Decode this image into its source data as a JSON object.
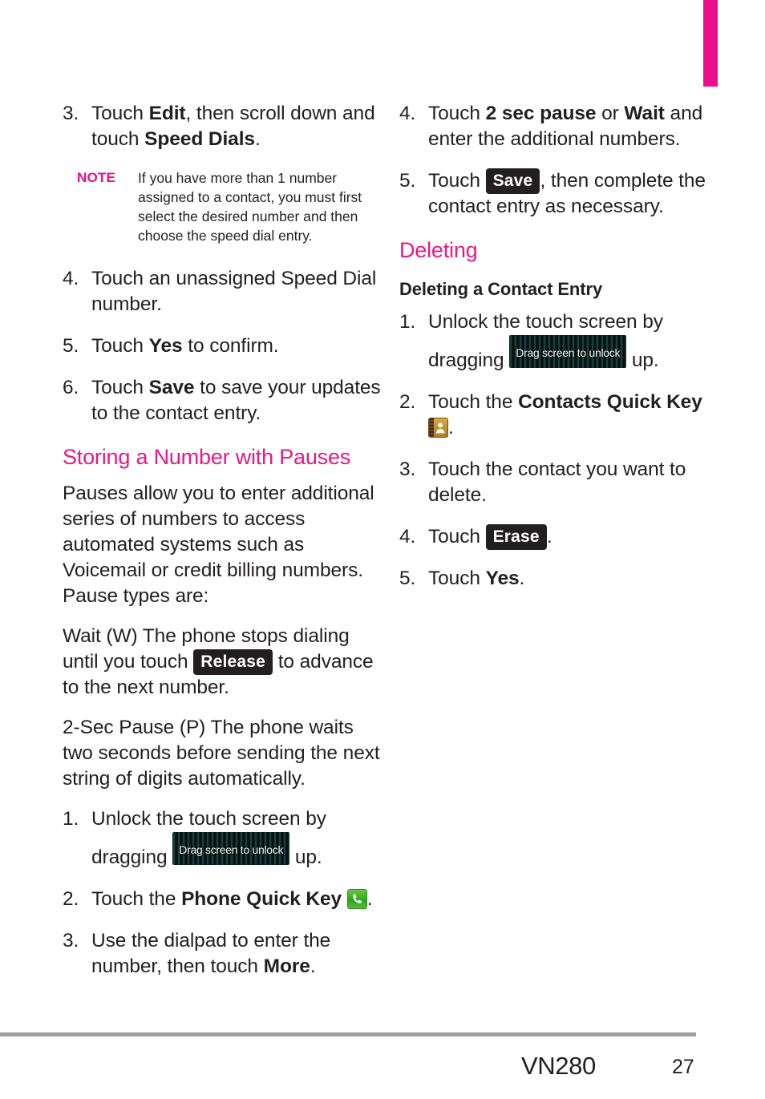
{
  "page": {
    "model": "VN280",
    "page_number": "27",
    "accent_color": "#ec1784",
    "tab_marker_color": "#ec0d8c"
  },
  "left_column": {
    "steps_speed_dial": [
      {
        "num": "3.",
        "pre": "Touch ",
        "b1": "Edit",
        "mid": ", then scroll down and touch ",
        "b2": "Speed Dials",
        "post": "."
      }
    ],
    "note": {
      "label": "NOTE",
      "text": "If you have more than 1 number assigned to a contact, you must first select the desired number and then choose the speed dial entry."
    },
    "steps_after_note": [
      {
        "num": "4.",
        "text": "Touch an unassigned Speed Dial number."
      },
      {
        "num": "5.",
        "pre": "Touch ",
        "b1": "Yes",
        "post": " to confirm."
      },
      {
        "num": "6.",
        "pre": "Touch ",
        "b1": "Save",
        "post": " to save your updates to the contact entry."
      }
    ],
    "heading": "Storing a Number with Pauses",
    "paragraph_1": "Pauses allow you to enter additional series of numbers to access automated systems such as Voicemail or credit billing numbers. Pause types are:",
    "paragraph_2_pre": "Wait (W) The phone stops dialing until you touch ",
    "paragraph_2_key": "Release",
    "paragraph_2_post": " to advance to the next number.",
    "paragraph_3": "2-Sec Pause (P) The phone waits two seconds before sending the next string of digits automatically.",
    "steps_pauses": [
      {
        "num": "1.",
        "pre": "Unlock the touch screen by dragging ",
        "key": "Drag screen to unlock",
        "post": " up."
      },
      {
        "num": "2.",
        "pre": "Touch the ",
        "b1": "Phone Quick Key",
        "icon": "phone-quick-key-icon",
        "post": "."
      },
      {
        "num": "3.",
        "pre": "Use the dialpad to enter the number, then touch ",
        "b1": "More",
        "post": "."
      }
    ]
  },
  "right_column": {
    "steps_pauses_cont": [
      {
        "num": "4.",
        "pre": "Touch ",
        "b1": "2 sec pause",
        "mid": " or ",
        "b2": "Wait",
        "post": " and enter the additional numbers."
      },
      {
        "num": "5.",
        "pre": "Touch ",
        "key": "Save",
        "post": ", then complete the contact entry as necessary."
      }
    ],
    "heading": "Deleting",
    "subheading": "Deleting a Contact Entry",
    "steps_deleting": [
      {
        "num": "1.",
        "pre": "Unlock the touch screen by dragging ",
        "key": "Drag screen to unlock",
        "post": " up."
      },
      {
        "num": "2.",
        "pre": "Touch the ",
        "b1": "Contacts Quick Key",
        "icon": "contacts-quick-key-icon",
        "post": "."
      },
      {
        "num": "3.",
        "text": "Touch the contact you want to delete."
      },
      {
        "num": "4.",
        "pre": "Touch ",
        "key": "Erase",
        "post": "."
      },
      {
        "num": "5.",
        "pre": "Touch ",
        "b1": "Yes",
        "post": "."
      }
    ]
  }
}
